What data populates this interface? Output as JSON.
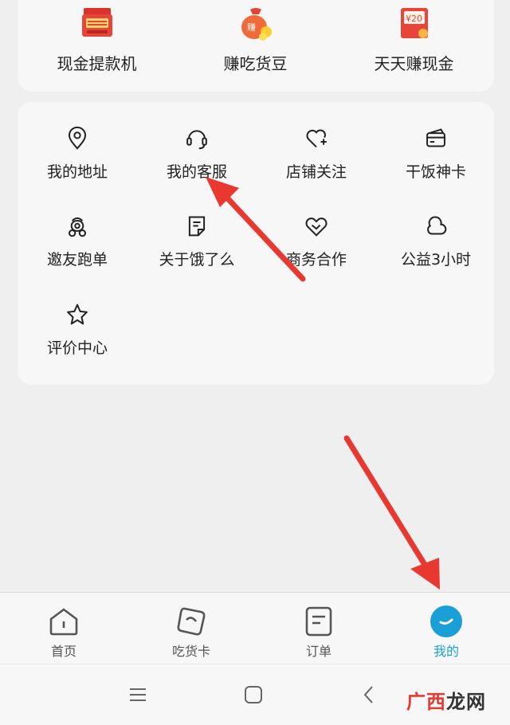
{
  "top_shortcuts": [
    {
      "label": "现金提款机",
      "icon": "atm-icon"
    },
    {
      "label": "赚吃货豆",
      "icon": "money-bag-icon",
      "icon_text": "赚"
    },
    {
      "label": "天天赚现金",
      "icon": "red-envelope-icon",
      "icon_text": "¥20"
    }
  ],
  "services": [
    {
      "label": "我的地址",
      "icon": "location-pin-icon"
    },
    {
      "label": "我的客服",
      "icon": "headset-icon"
    },
    {
      "label": "店铺关注",
      "icon": "heart-plus-icon"
    },
    {
      "label": "干饭神卡",
      "icon": "card-icon"
    },
    {
      "label": "邀友跑单",
      "icon": "scooter-icon"
    },
    {
      "label": "关于饿了么",
      "icon": "document-icon"
    },
    {
      "label": "商务合作",
      "icon": "handshake-icon"
    },
    {
      "label": "公益3小时",
      "icon": "cloud-icon"
    },
    {
      "label": "评价中心",
      "icon": "star-icon"
    }
  ],
  "tabbar": {
    "tabs": [
      {
        "label": "首页",
        "icon": "home-icon"
      },
      {
        "label": "吃货卡",
        "icon": "food-card-icon"
      },
      {
        "label": "订单",
        "icon": "order-icon"
      },
      {
        "label": "我的",
        "icon": "profile-icon",
        "active": true
      }
    ]
  },
  "watermark": {
    "part1": "广西",
    "part2": "龙网"
  },
  "colors": {
    "accent": "#1aa0d6",
    "arrow": "#e8382f",
    "background": "#efefef",
    "card": "#f7f7f7"
  }
}
